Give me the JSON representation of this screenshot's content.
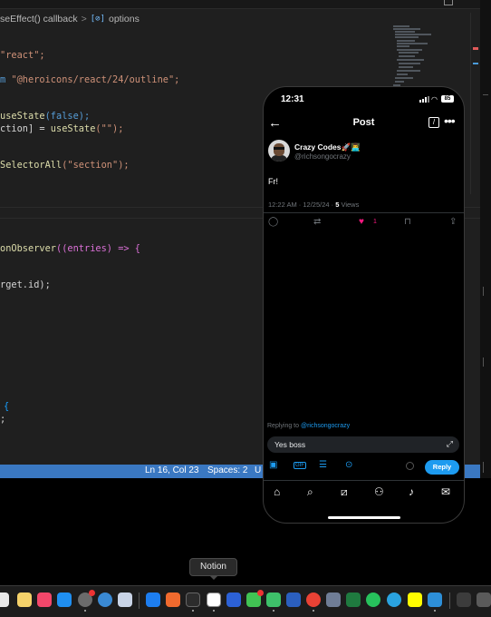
{
  "editor": {
    "breadcrumb": {
      "item1": "seEffect() callback",
      "sep": ">",
      "item2_icon": "[⊘]",
      "item2": "options"
    },
    "code_lines": [
      {
        "t1": "\"react\";"
      },
      {
        "t1": "m",
        "t2": "\"@heroicons/react/24/outline\";"
      },
      {
        "t1": "useState",
        "t2": "(false);"
      },
      {
        "t1": "ction] = ",
        "t2": "useState",
        "t3": "(\"\");"
      },
      {
        "t1": "SelectorAll",
        "t2": "(\"section\");"
      },
      {
        "t1": "onObserver",
        "t2": "((entries) => {"
      },
      {
        "t1": "rget.id);"
      },
      {
        "t1": "{"
      },
      {
        "t1": ";"
      }
    ],
    "status": {
      "position": "Ln 16, Col 23",
      "spaces": "Spaces: 2",
      "enc": "U"
    }
  },
  "phone": {
    "time": "12:31",
    "battery": "85",
    "nav_title": "Post",
    "author_name": "Crazy Codes🚀👨‍💻",
    "author_handle": "@richsongocrazy",
    "post_text": "Fr!",
    "meta_time": "12:22 AM · 12/25/24 · ",
    "meta_views_count": "5",
    "meta_views_label": " Views",
    "like_count": "1",
    "replying_to_label": "Replying to ",
    "replying_to_user": "@richsongocrazy",
    "reply_input_value": "Yes boss",
    "reply_button": "Reply",
    "colors": {
      "accent": "#1d9bf0",
      "like": "#f91880"
    }
  },
  "tooltip": "Notion",
  "dock": {
    "icons": [
      "finder-icon",
      "notes-icon",
      "music-icon",
      "app-store-icon",
      "system-settings-icon",
      "safari-icon",
      "preview-icon",
      "shazam-icon",
      "terminal-icon",
      "notion-icon",
      "vpn-icon",
      "messages-icon",
      "facetime-icon",
      "word-icon",
      "chrome-icon",
      "finder-2-icon",
      "excel-icon",
      "photos-icon",
      "whatsapp-icon",
      "telegram-icon",
      "snapchat-icon",
      "vscode-icon",
      "desktop-icon",
      "trash-icon"
    ]
  }
}
